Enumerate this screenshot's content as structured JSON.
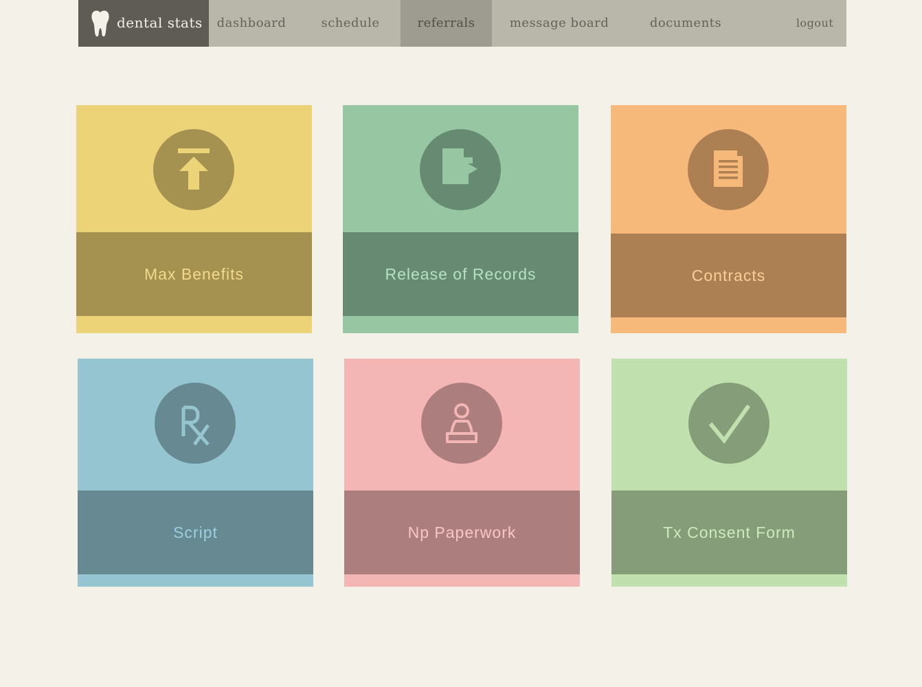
{
  "app": {
    "name": "dental stats",
    "logo_icon": "tooth-icon"
  },
  "nav": {
    "items": [
      {
        "label": "dashboard",
        "active": false
      },
      {
        "label": "schedule",
        "active": false
      },
      {
        "label": "referrals",
        "active": true
      },
      {
        "label": "message board",
        "active": false
      },
      {
        "label": "documents",
        "active": false
      }
    ],
    "logout_label": "logout"
  },
  "cards": [
    {
      "label": "Max Benefits",
      "icon": "upload-icon",
      "colors": {
        "bg": "#edd378",
        "dark": "#a59150",
        "label": "#f3d98a"
      }
    },
    {
      "label": "Release of Records",
      "icon": "file-export-icon",
      "colors": {
        "bg": "#97c6a2",
        "dark": "#678a72",
        "label": "#b4e2c0"
      }
    },
    {
      "label": "Contracts",
      "icon": "document-icon",
      "colors": {
        "bg": "#f6b97a",
        "dark": "#ad8053",
        "label": "#f9cf98"
      }
    },
    {
      "label": "Script",
      "icon": "rx-icon",
      "colors": {
        "bg": "#95c5d1",
        "dark": "#678992",
        "label": "#99cfde"
      }
    },
    {
      "label": "Np Paperwork",
      "icon": "person-icon",
      "colors": {
        "bg": "#f4b5b5",
        "dark": "#ad7e7e",
        "label": "#f8c6c6"
      }
    },
    {
      "label": "Tx Consent Form",
      "icon": "checkmark-icon",
      "colors": {
        "bg": "#c0e1ad",
        "dark": "#859e79",
        "label": "#cdebbc"
      }
    }
  ]
}
